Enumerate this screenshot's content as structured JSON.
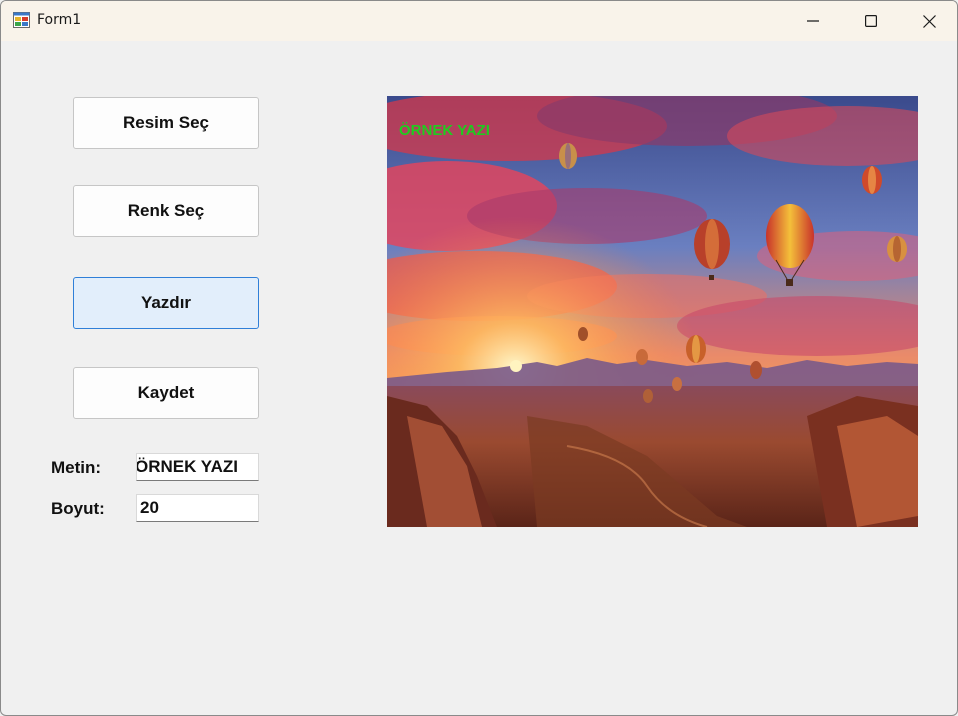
{
  "window": {
    "title": "Form1"
  },
  "buttons": {
    "select_image": "Resim Seç",
    "select_color": "Renk Seç",
    "print": "Yazdır",
    "save": "Kaydet"
  },
  "fields": {
    "text_label": "Metin:",
    "text_value": "ÖRNEK YAZI",
    "size_label": "Boyut:",
    "size_value": "20"
  },
  "picture": {
    "overlay_text": "ÖRNEK YAZI",
    "overlay_color": "#1fcc1f"
  },
  "icons": {
    "app": "winforms-app-icon",
    "minimize": "minimize-icon",
    "maximize": "maximize-icon",
    "close": "close-icon"
  },
  "colors": {
    "title_bar": "#f9f3ea",
    "client_bg": "#f0f0f0",
    "focused_button_border": "#2f7fd8",
    "focused_button_bg": "#e2eefb"
  }
}
